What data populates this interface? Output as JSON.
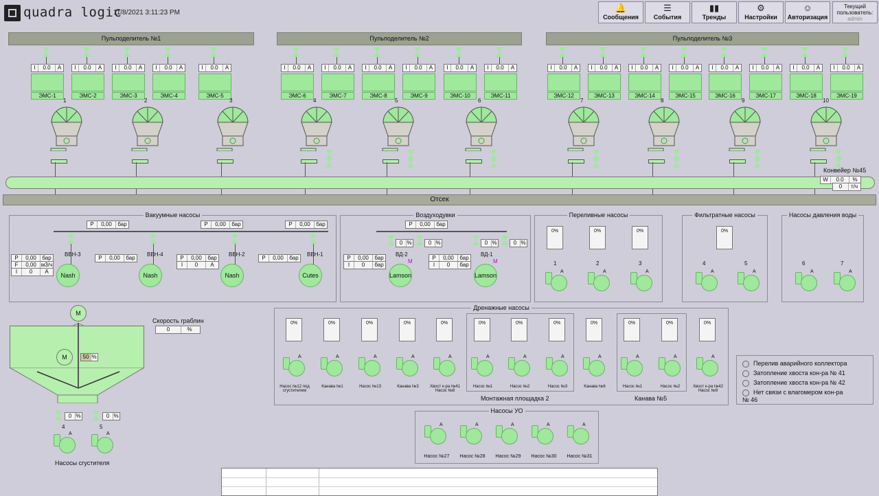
{
  "header": {
    "logo_text": "quadra logic",
    "datetime": "11/8/2021 3:11:23 PM",
    "nav": [
      {
        "label": "Сообщения",
        "icon": "bell-icon"
      },
      {
        "label": "События",
        "icon": "list-icon"
      },
      {
        "label": "Тренды",
        "icon": "chart-icon"
      },
      {
        "label": "Настройки",
        "icon": "settings-icon"
      },
      {
        "label": "Авторизация",
        "icon": "user-icon"
      }
    ],
    "user_label": "Текущий пользователь:",
    "user": "admin"
  },
  "distributors": [
    "Пульподелитель №1",
    "Пульподелитель №2",
    "Пульподелитель №3"
  ],
  "ems": [
    {
      "name": "ЭМС-1",
      "v": "0.0"
    },
    {
      "name": "ЭМС-2",
      "v": "0.0"
    },
    {
      "name": "ЭМС-3",
      "v": "0.0"
    },
    {
      "name": "ЭМС-4",
      "v": "0.0"
    },
    {
      "name": "ЭМС-5",
      "v": "0.0"
    },
    {
      "name": "ЭМС-6",
      "v": "0.0"
    },
    {
      "name": "ЭМС-7",
      "v": "0.0"
    },
    {
      "name": "ЭМС-8",
      "v": "0.0"
    },
    {
      "name": "ЭМС-9",
      "v": "0.0"
    },
    {
      "name": "ЭМС-10",
      "v": "0.0"
    },
    {
      "name": "ЭМС-11",
      "v": "0.0"
    },
    {
      "name": "ЭМС-12",
      "v": "0.0"
    },
    {
      "name": "ЭМС-13",
      "v": "0.0"
    },
    {
      "name": "ЭМС-14",
      "v": "0.0"
    },
    {
      "name": "ЭМС-15",
      "v": "0.0"
    },
    {
      "name": "ЭМС-16",
      "v": "0.0"
    },
    {
      "name": "ЭМС-17",
      "v": "0.0"
    },
    {
      "name": "ЭМС-18",
      "v": "0.0"
    },
    {
      "name": "ЭМС-19",
      "v": "0.0"
    }
  ],
  "ems_i": "I",
  "ems_unit": "A",
  "hoppers": [
    "1",
    "2",
    "3",
    "4",
    "5",
    "6",
    "7",
    "8",
    "9",
    "10"
  ],
  "conveyor": {
    "name": "Конвейер №45",
    "w_label": "W",
    "w": "0.0",
    "w_unit": "%",
    "v2": "0",
    "v2_unit": "т/ч"
  },
  "otsek": "Отсек",
  "vacuum": {
    "title": "Вакуумные насосы",
    "p_label": "P",
    "f_label": "F",
    "i_label": "I",
    "bar": "бар",
    "p_main": [
      "0,00",
      "0,00",
      "0,00"
    ],
    "pumps": [
      {
        "name": "ВВН-3",
        "type": "Nash",
        "p": "0,00",
        "f": "0,00",
        "f_unit": "м3/ч",
        "i": "0",
        "i_unit": "A"
      },
      {
        "name": "ВВН-4",
        "type": "Nash",
        "p": "0,00"
      },
      {
        "name": "ВВН-2",
        "type": "Nash",
        "p": "0,00",
        "i": "0",
        "i_unit": "A"
      },
      {
        "name": "ВВН-1",
        "type": "Cutes",
        "p": "0,00"
      }
    ]
  },
  "blowers": {
    "title": "Воздуходувки",
    "p": "0,00",
    "bar": "бар",
    "pumps": [
      {
        "name": "ВД-2",
        "type": "Lamson",
        "p": "0,00",
        "i": "0",
        "v1": "0",
        "v2": "0"
      },
      {
        "name": "ВД-1",
        "type": "Lamson",
        "p": "0,00",
        "i": "0",
        "v1": "0",
        "v2": "0"
      }
    ],
    "m": "M",
    "pct": "%"
  },
  "overflow": {
    "title": "Переливные насосы",
    "cards": [
      "0%",
      "0%",
      "0%"
    ],
    "pumps": [
      "1",
      "2",
      "3"
    ]
  },
  "filtrate": {
    "title": "Фильтратные насосы",
    "cards": [
      "0%"
    ],
    "pumps": [
      "4",
      "5"
    ]
  },
  "water": {
    "title": "Насосы давления воды",
    "pumps": [
      "6",
      "7"
    ]
  },
  "rakes": {
    "label": "Скорость граблин",
    "value": "0",
    "unit": "%",
    "m": "M",
    "pct_val": "50",
    "pct_unit": "%"
  },
  "thickener": {
    "title": "Насосы сгустителя",
    "valves": [
      {
        "v": "0",
        "u": "%"
      },
      {
        "v": "0",
        "u": "%"
      }
    ],
    "pumps": [
      "4",
      "5"
    ]
  },
  "drain": {
    "title": "Дренажные насосы",
    "cards": [
      "0%",
      "0%",
      "0%",
      "0%",
      "0%",
      "0%",
      "0%",
      "0%",
      "0%",
      "0%",
      "0%",
      "0%"
    ],
    "pumps": [
      "Насос №12 под сгустителем",
      "Канава №1",
      "Насос №13",
      "Канава №3",
      "Хвост к-ра №41 Насос №8",
      "Насос №1",
      "Насос №2",
      "Насос №3",
      "Канава №6",
      "Насос №1",
      "Насос №2",
      "Хвост к-ра №42 Насос №9"
    ],
    "sub1": "Монтажная площадка 2",
    "sub2": "Канава №5"
  },
  "uo": {
    "title": "Насосы УО",
    "pumps": [
      "Насос №27",
      "Насос №28",
      "Насос №29",
      "Насос №30",
      "Насос №31"
    ]
  },
  "alarms": [
    "Перелив аварийного коллектора",
    "Затопление хвоста кон-ра № 41",
    "Затопление хвоста кон-ра № 42",
    "Нет связи с влагомером кон-ра № 46"
  ],
  "pump_a": "A"
}
